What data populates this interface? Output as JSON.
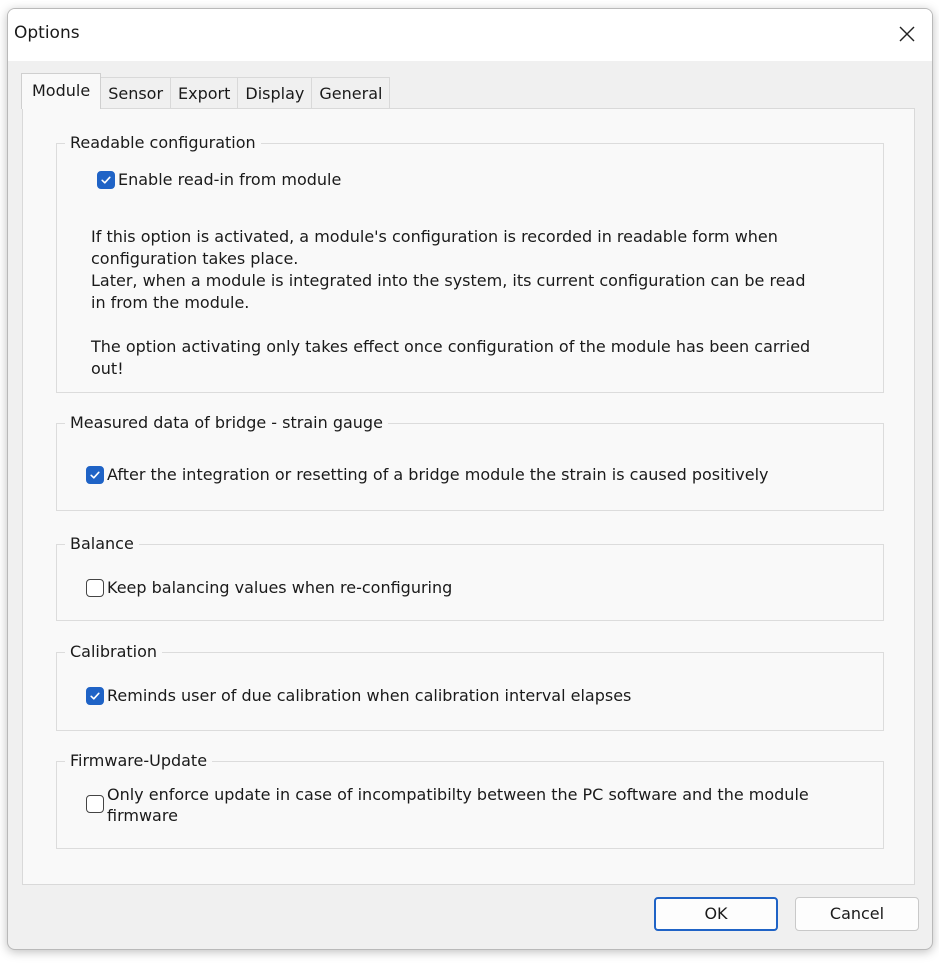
{
  "window": {
    "title": "Options"
  },
  "tabs": [
    {
      "label": "Module",
      "active": true
    },
    {
      "label": "Sensor",
      "active": false
    },
    {
      "label": "Export",
      "active": false
    },
    {
      "label": "Display",
      "active": false
    },
    {
      "label": "General",
      "active": false
    }
  ],
  "groups": {
    "readable": {
      "legend": "Readable configuration",
      "checkbox_label": "Enable read-in from module",
      "checked": true,
      "desc_line1": "If this option is activated, a module's configuration is recorded in readable form when",
      "desc_line2": "configuration takes place.",
      "desc_line3": "Later, when a module is integrated into the system, its current configuration can be read",
      "desc_line4": "in from the module.",
      "desc_line5": "The option activating only takes effect once configuration of the module has been carried",
      "desc_line6": "out!"
    },
    "measured": {
      "legend": "Measured data of bridge - strain gauge",
      "checkbox_label": "After the integration or resetting of a bridge module the strain is caused positively",
      "checked": true
    },
    "balance": {
      "legend": "Balance",
      "checkbox_label": "Keep balancing values when re-configuring",
      "checked": false
    },
    "calibration": {
      "legend": "Calibration",
      "checkbox_label": "Reminds user of due calibration when calibration interval elapses",
      "checked": true
    },
    "firmware": {
      "legend": "Firmware-Update",
      "checkbox_label_line1": "Only enforce update in case of incompatibilty between the PC software and the module",
      "checkbox_label_line2": "firmware",
      "checked": false
    }
  },
  "buttons": {
    "ok": "OK",
    "cancel": "Cancel"
  },
  "colors": {
    "accent": "#1f63c6",
    "dialog_bg": "#f0f0f0",
    "panel_bg": "#f9f9f9"
  }
}
